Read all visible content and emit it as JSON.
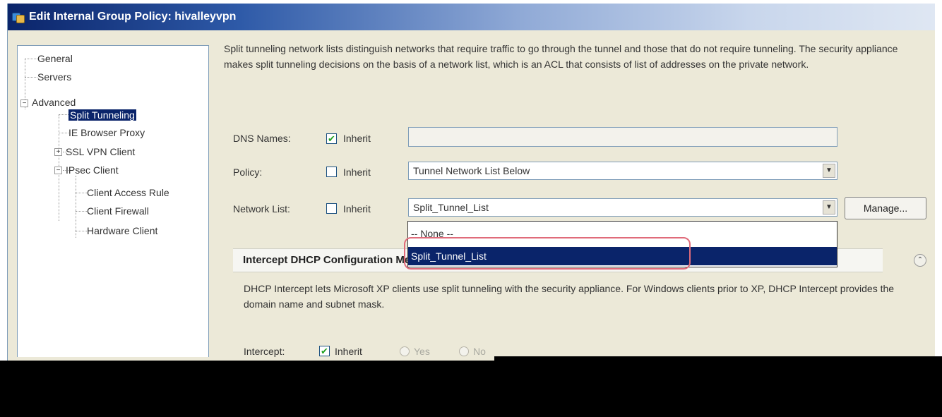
{
  "window": {
    "title": "Edit Internal Group Policy: hivalleyvpn"
  },
  "tree": {
    "general": "General",
    "servers": "Servers",
    "advanced": "Advanced",
    "split_tunneling": "Split Tunneling",
    "ie_browser_proxy": "IE Browser Proxy",
    "ssl_vpn_client": "SSL VPN Client",
    "ipsec_client": "IPsec Client",
    "client_access_rule": "Client Access Rule",
    "client_firewall": "Client Firewall",
    "hardware_client": "Hardware Client",
    "expand_plus": "+",
    "expand_minus": "−"
  },
  "intro": "Split tunneling network lists distinguish networks that require traffic to go through the tunnel and those that do not require tunneling. The security appliance makes split tunneling decisions on the basis of a network list, which is an ACL that consists of list of addresses on the private network.",
  "form": {
    "dns_label": "DNS Names:",
    "dns_inherit_checked": true,
    "dns_value": "",
    "policy_label": "Policy:",
    "policy_inherit_checked": false,
    "policy_value": "Tunnel Network List Below",
    "netlist_label": "Network List:",
    "netlist_inherit_checked": false,
    "netlist_value": "Split_Tunnel_List",
    "inherit_label": "Inherit",
    "manage_button": "Manage...",
    "check_mark": "✔",
    "combo_arrow": "▼"
  },
  "dropdown": {
    "options": [
      "-- None --",
      "Split_Tunnel_List"
    ],
    "highlighted": "Split_Tunnel_List"
  },
  "dhcp": {
    "section_title": "Intercept DHCP Configuration Message",
    "collapse_glyph": "⌃",
    "description": "DHCP Intercept lets Microsoft XP clients use split tunneling with the security appliance. For Windows clients prior to XP, DHCP Intercept provides the domain name and subnet mask.",
    "intercept_label": "Intercept:",
    "inherit_label": "Inherit",
    "inherit_checked": true,
    "yes_label": "Yes",
    "no_label": "No"
  },
  "colors": {
    "selection": "#0a246a",
    "callout": "#e06b7a",
    "dialog_bg": "#ece9d8"
  }
}
